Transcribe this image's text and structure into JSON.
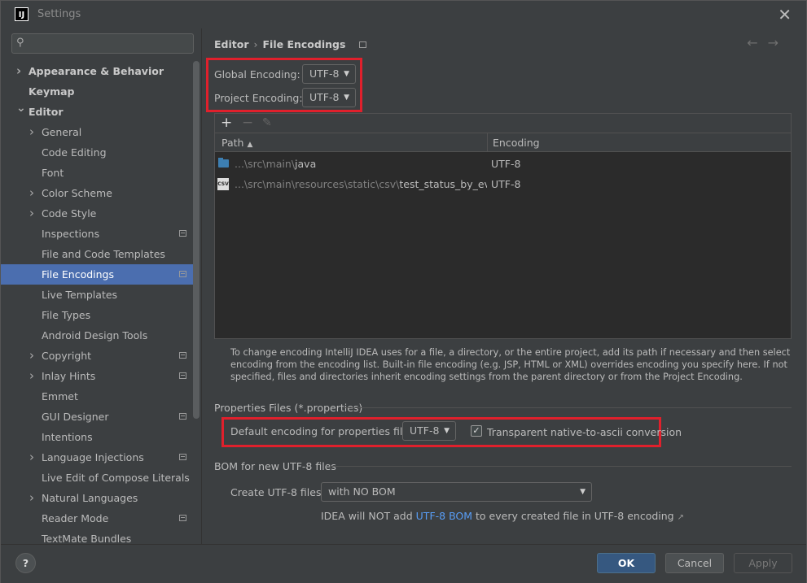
{
  "window": {
    "title": "Settings",
    "app_icon_text": "IJ"
  },
  "search": {
    "placeholder": ""
  },
  "sidebar": {
    "items": [
      {
        "label": "Appearance & Behavior",
        "bold": true,
        "arrow": "right",
        "indent": 0
      },
      {
        "label": "Keymap",
        "bold": true,
        "indent": 0
      },
      {
        "label": "Editor",
        "bold": true,
        "arrow": "down",
        "indent": 0
      },
      {
        "label": "General",
        "arrow": "right",
        "indent": 1
      },
      {
        "label": "Code Editing",
        "indent": 1
      },
      {
        "label": "Font",
        "indent": 1
      },
      {
        "label": "Color Scheme",
        "arrow": "right",
        "indent": 1
      },
      {
        "label": "Code Style",
        "arrow": "right",
        "indent": 1
      },
      {
        "label": "Inspections",
        "indent": 1,
        "mini": true
      },
      {
        "label": "File and Code Templates",
        "indent": 1
      },
      {
        "label": "File Encodings",
        "indent": 1,
        "mini": true,
        "selected": true
      },
      {
        "label": "Live Templates",
        "indent": 1
      },
      {
        "label": "File Types",
        "indent": 1
      },
      {
        "label": "Android Design Tools",
        "indent": 1
      },
      {
        "label": "Copyright",
        "arrow": "right",
        "indent": 1,
        "mini": true
      },
      {
        "label": "Inlay Hints",
        "arrow": "right",
        "indent": 1,
        "mini": true
      },
      {
        "label": "Emmet",
        "indent": 1
      },
      {
        "label": "GUI Designer",
        "indent": 1,
        "mini": true
      },
      {
        "label": "Intentions",
        "indent": 1
      },
      {
        "label": "Language Injections",
        "arrow": "right",
        "indent": 1,
        "mini": true
      },
      {
        "label": "Live Edit of Compose Literals",
        "indent": 1
      },
      {
        "label": "Natural Languages",
        "arrow": "right",
        "indent": 1
      },
      {
        "label": "Reader Mode",
        "indent": 1,
        "mini": true
      },
      {
        "label": "TextMate Bundles",
        "indent": 1
      }
    ]
  },
  "breadcrumb": {
    "parent": "Editor",
    "current": "File Encodings"
  },
  "encoding": {
    "global_label": "Global Encoding:",
    "global_value": "UTF-8",
    "project_label": "Project Encoding:",
    "project_value": "UTF-8"
  },
  "table": {
    "toolbar": {
      "add": "+",
      "remove": "−",
      "edit": "✎"
    },
    "col_path": "Path",
    "col_encoding": "Encoding",
    "rows": [
      {
        "path_dim": "...\\src\\main\\",
        "path_main": "java",
        "encoding": "UTF-8"
      },
      {
        "path_dim": "...\\src\\main\\resources\\static\\csv\\",
        "path_main": "test_status_by_event.",
        "encoding": "UTF-8"
      }
    ]
  },
  "description": "To change encoding IntelliJ IDEA uses for a file, a directory, or the entire project, add its path if necessary and then select encoding from the encoding list. Built-in file encoding (e.g. JSP, HTML or XML) overrides encoding you specify here. If not specified, files and directories inherit encoding settings from the parent directory or from the Project Encoding.",
  "properties": {
    "section": "Properties Files (*.properties)",
    "default_label": "Default encoding for properties files:",
    "default_value": "UTF-8",
    "transparent_label": "Transparent native-to-ascii conversion",
    "transparent_checked": true
  },
  "bom": {
    "section": "BOM for new UTF-8 files",
    "create_label": "Create UTF-8 files:",
    "create_value": "with NO BOM",
    "note_prefix": "IDEA will NOT add ",
    "note_link": "UTF-8 BOM",
    "note_suffix": " to every created file in UTF-8 encoding ",
    "note_ext": "↗"
  },
  "footer": {
    "ok": "OK",
    "cancel": "Cancel",
    "apply": "Apply",
    "help": "?"
  },
  "colors": {
    "selection": "#4b6eaf",
    "highlight_box": "#e0202c",
    "link": "#589df6",
    "ok_button": "#365880"
  }
}
